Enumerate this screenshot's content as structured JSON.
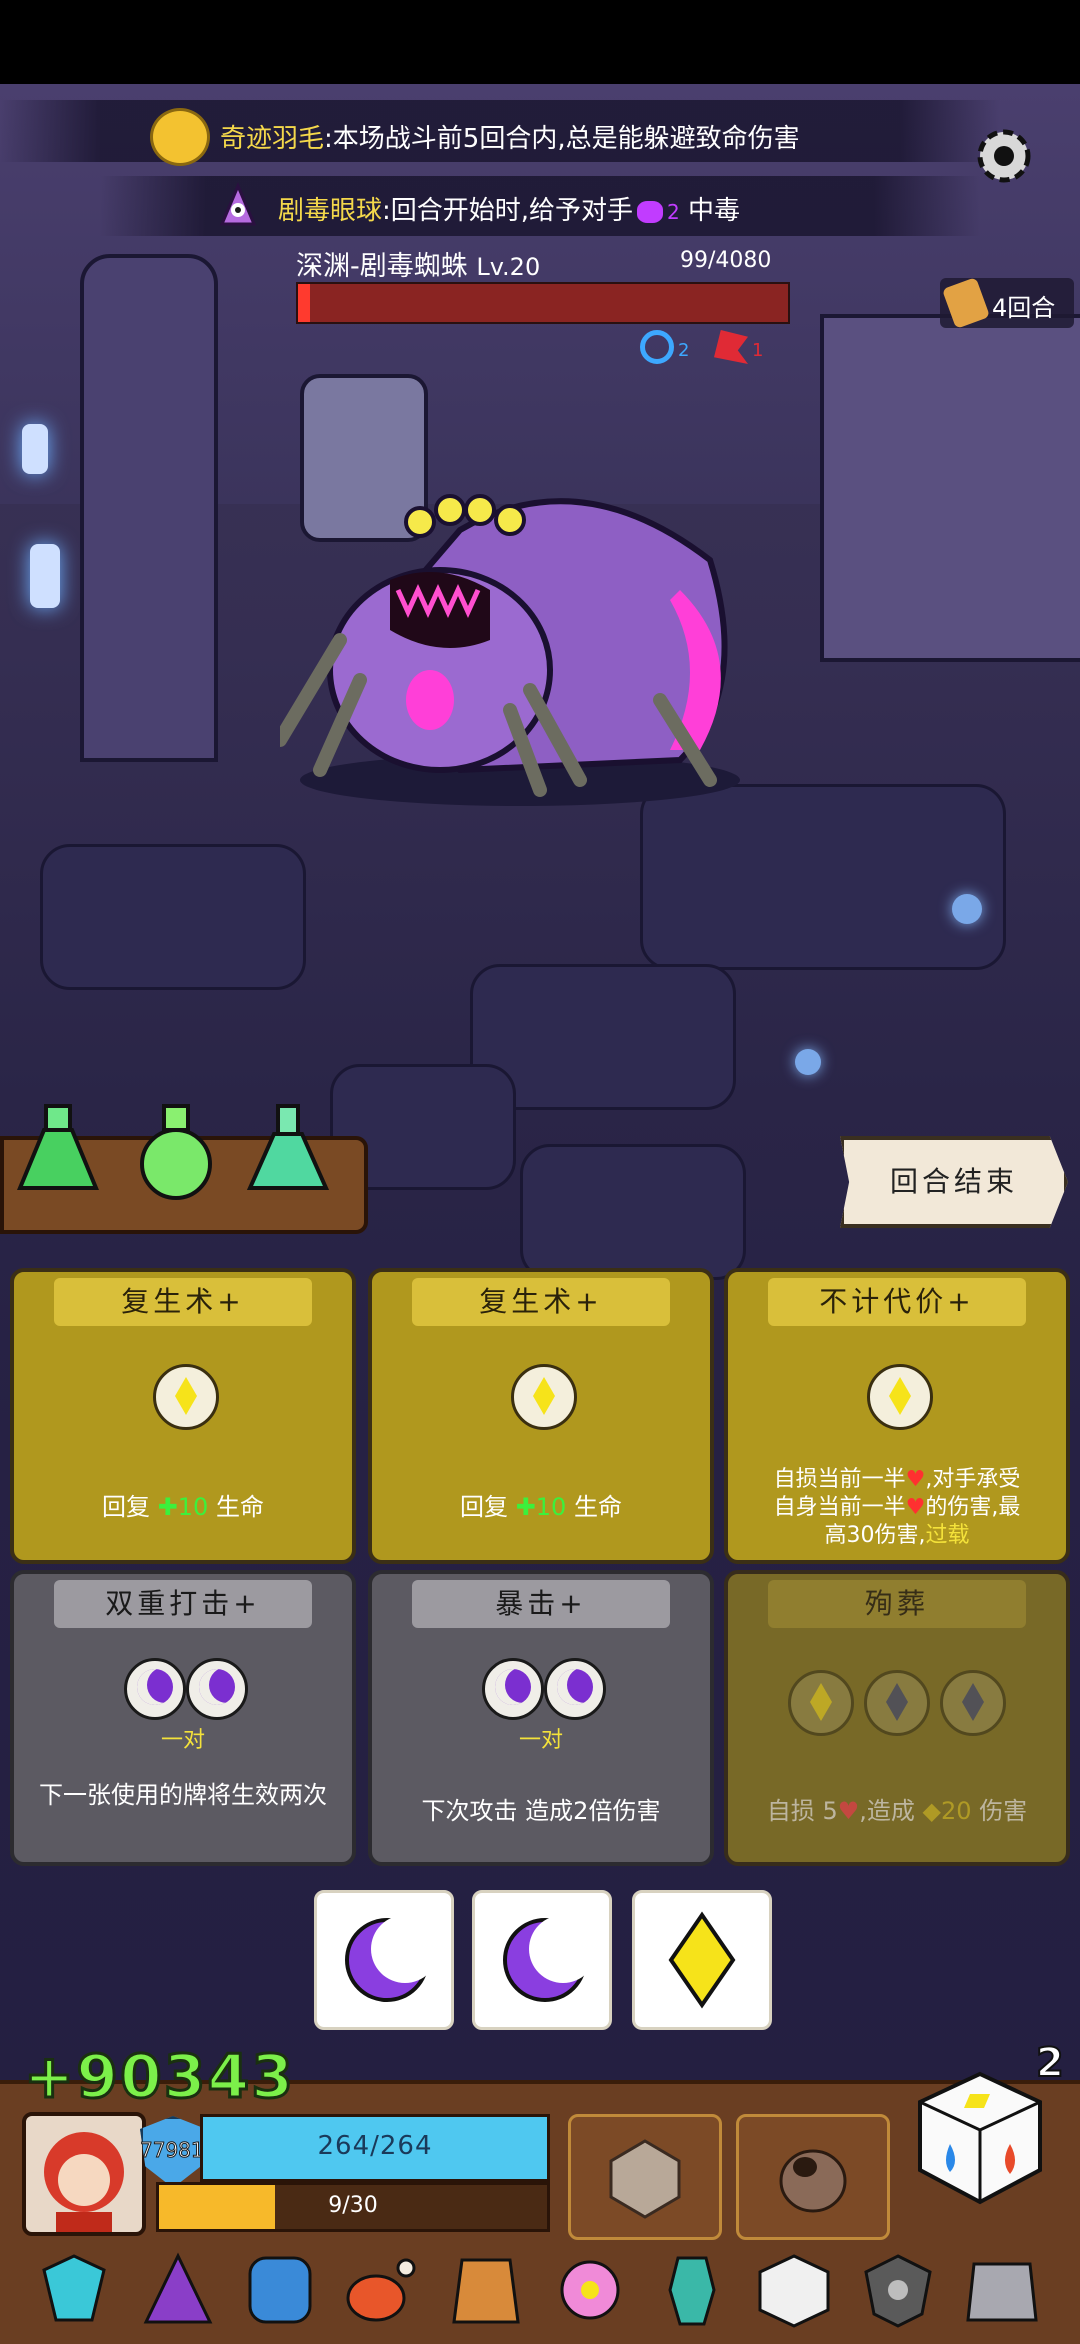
{
  "relic_1": {
    "name": "奇迹羽毛",
    "text": ":本场战斗前5回合内,总是能躲避致命伤害"
  },
  "relic_2": {
    "name": "剧毒眼球",
    "text_pre": ":回合开始时,给予对手",
    "count": "2",
    "text_post": "中毒"
  },
  "enemy": {
    "name": "深渊-剧毒蜘蛛",
    "level": "Lv.20",
    "hp_text": "99/4080",
    "hp_fraction": 0.024,
    "buff_shield": "2",
    "buff_rage": "1"
  },
  "turn": {
    "label": "4回合"
  },
  "end_turn": {
    "label": "回合结束"
  },
  "cards": [
    {
      "title": "复生术+",
      "desc_pre": "回复",
      "amount": "10",
      "desc_post": "生命"
    },
    {
      "title": "复生术+",
      "desc_pre": "回复",
      "amount": "10",
      "desc_post": "生命"
    },
    {
      "title": "不计代价+",
      "desc_line1": "自损当前一半",
      "desc_line1b": ",对手承受",
      "desc_line2": "自身当前一半",
      "desc_line2b": "的伤害,最",
      "desc_line3": "高30伤害,",
      "desc_keyword": "过载"
    },
    {
      "title": "双重打击+",
      "pair": "一对",
      "desc": "下一张使用的牌将生效两次"
    },
    {
      "title": "暴击+",
      "pair": "一对",
      "desc": "下次攻击 造成2倍伤害"
    },
    {
      "title": "殉葬",
      "desc_pre": "自损",
      "self_dmg": "5",
      "desc_mid": ",造成",
      "dmg": "20",
      "desc_post": "伤害"
    }
  ],
  "score_popup": "+90343",
  "dice_count": "2",
  "player": {
    "shield": "77981",
    "hp_text": "264/264",
    "hp_fraction": 1.0,
    "energy_text": "9/30",
    "energy_fraction": 0.3
  },
  "colors": {
    "accent_gold": "#b0981e",
    "hp_blue": "#4fc8f0",
    "energy_yellow": "#f7b92a",
    "enemy_hp": "#ff3a2e",
    "poison": "#c13cff"
  },
  "hand_dice": [
    "moon-icon",
    "moon-icon",
    "diamond-icon"
  ],
  "equipment_icons": [
    "crystal-icon",
    "wizard-hat-icon",
    "shield-icon",
    "meat-icon",
    "vest-icon",
    "flower-icon",
    "vase-icon",
    "dice-icon",
    "gem-shield-icon",
    "armor-icon"
  ]
}
